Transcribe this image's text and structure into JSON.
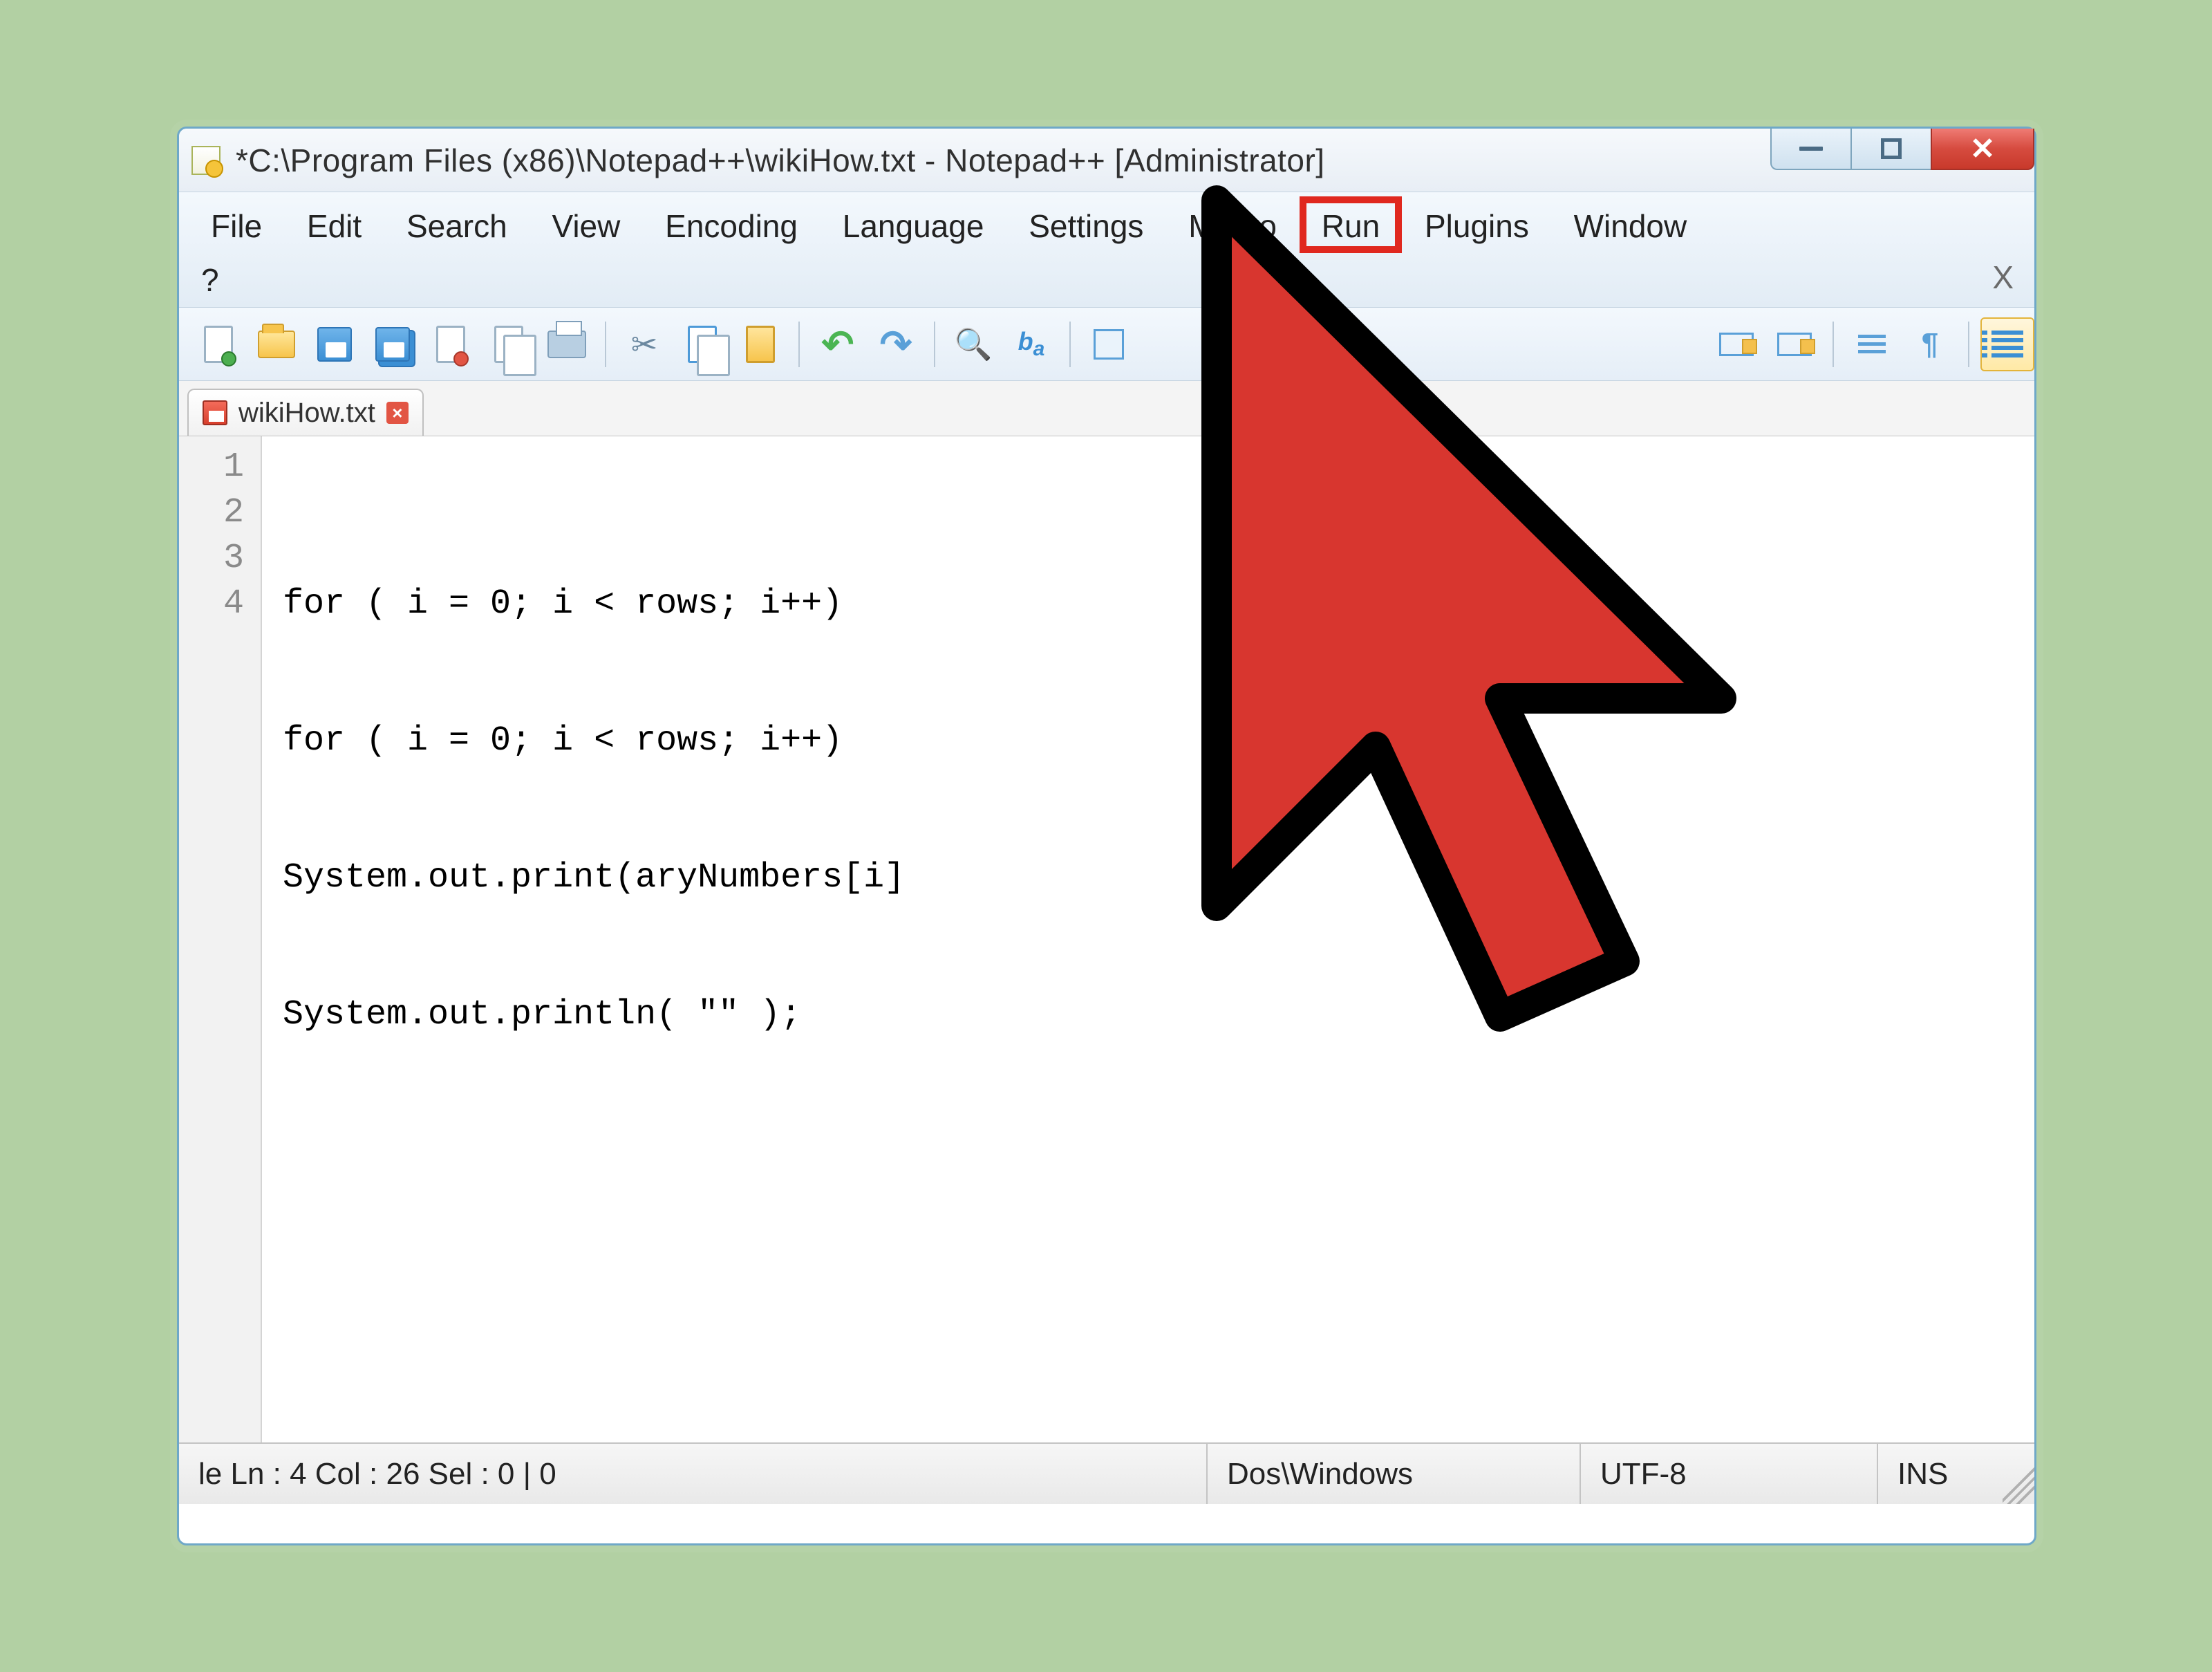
{
  "titlebar": {
    "title": "*C:\\Program Files (x86)\\Notepad++\\wikiHow.txt - Notepad++ [Administrator]"
  },
  "menus": {
    "file": "File",
    "edit": "Edit",
    "search": "Search",
    "view": "View",
    "encoding": "Encoding",
    "language": "Language",
    "settings": "Settings",
    "macro": "Macro",
    "run": "Run",
    "plugins": "Plugins",
    "window": "Window",
    "help": "?",
    "close_x": "X"
  },
  "tab": {
    "label": "wikiHow.txt",
    "close": "×"
  },
  "gutter": {
    "l1": "1",
    "l2": "2",
    "l3": "3",
    "l4": "4"
  },
  "code": {
    "l1": "for ( i = 0; i < rows; i++)",
    "l2": "for ( i = 0; i < rows; i++)",
    "l3": "System.out.print(aryNumbers[i]",
    "l4": "System.out.println( \"\" );"
  },
  "status": {
    "pos": "le Ln : 4    Col : 26    Sel : 0 | 0",
    "eol": "Dos\\Windows",
    "enc": "UTF-8",
    "ins": "INS"
  },
  "highlight": {
    "target": "run"
  }
}
